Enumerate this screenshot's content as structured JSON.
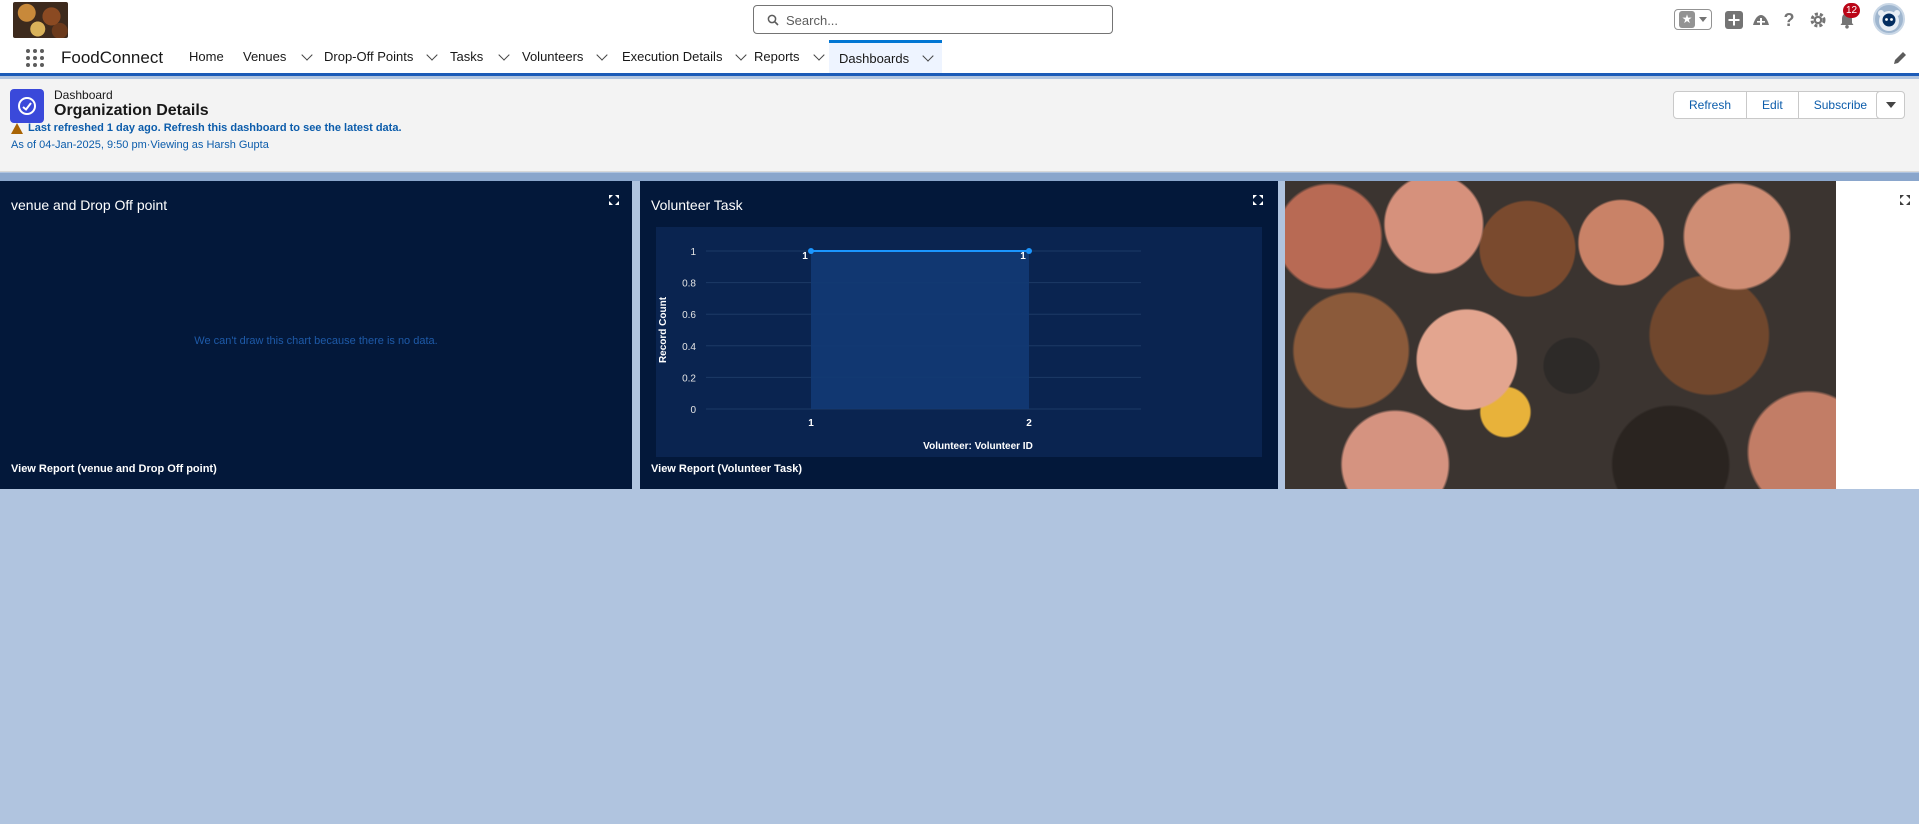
{
  "header": {
    "search_placeholder": "Search...",
    "notification_count": "12"
  },
  "nav": {
    "app_name": "FoodConnect",
    "items": [
      {
        "label": "Home"
      },
      {
        "label": "Venues"
      },
      {
        "label": "Drop-Off Points"
      },
      {
        "label": "Tasks"
      },
      {
        "label": "Volunteers"
      },
      {
        "label": "Execution Details"
      },
      {
        "label": "Reports"
      },
      {
        "label": "Dashboards"
      }
    ],
    "active": "Dashboards"
  },
  "dashboard": {
    "kicker": "Dashboard",
    "title": "Organization Details",
    "refresh_warning": "Last refreshed 1 day ago. Refresh this dashboard to see the latest data.",
    "as_of": "As of 04-Jan-2025, 9:50 pm·Viewing as Harsh Gupta",
    "buttons": {
      "refresh": "Refresh",
      "edit": "Edit",
      "subscribe": "Subscribe"
    }
  },
  "widgets": {
    "venue": {
      "title": "venue and Drop Off point",
      "no_data": "We can't draw this chart because there is no data.",
      "footer": "View Report (venue and Drop Off point)"
    },
    "volunteer": {
      "title": "Volunteer Task",
      "footer": "View Report (Volunteer Task)"
    }
  },
  "colors": {
    "widget_bg": "#03183a",
    "chart_bg": "#0a2450",
    "line": "#1b96ff",
    "brand": "#0176d3"
  },
  "chart_data": {
    "type": "area",
    "categories": [
      "1",
      "2"
    ],
    "values": [
      1,
      1
    ],
    "data_labels": [
      "1",
      "1"
    ],
    "xlabel": "Volunteer: Volunteer ID",
    "ylabel": "Record Count",
    "ylim": [
      0,
      1
    ],
    "yticks": [
      "0",
      "0.2",
      "0.4",
      "0.6",
      "0.8",
      "1"
    ],
    "grid": true
  }
}
